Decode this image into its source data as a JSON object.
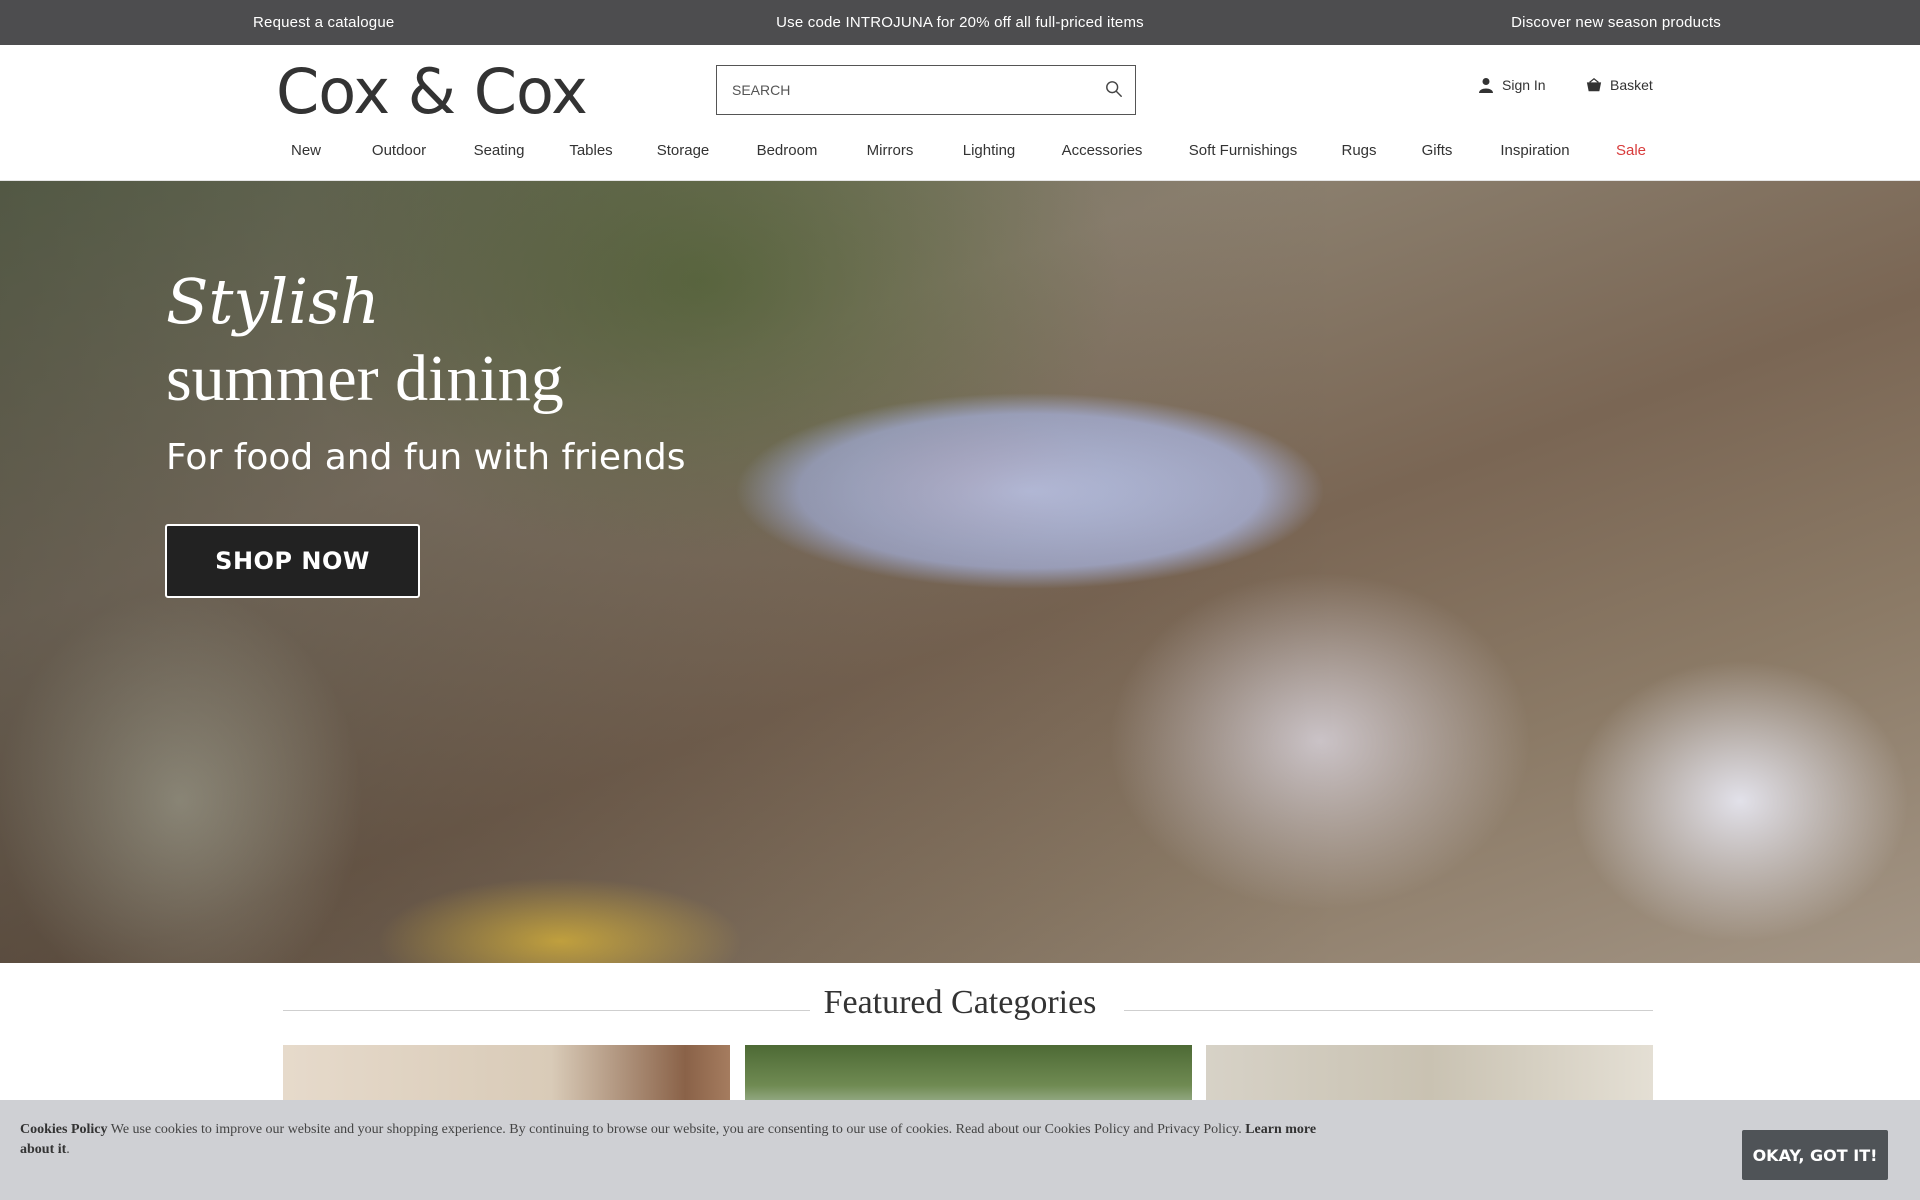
{
  "promo": {
    "left": "Request a catalogue",
    "center": "Use code INTROJUNA for 20% off all full-priced items",
    "right": "Discover new season products"
  },
  "header": {
    "logo": "Cox & Cox",
    "search_placeholder": "SEARCH",
    "sign_in": "Sign In",
    "basket": "Basket"
  },
  "nav": {
    "items": [
      "New",
      "Outdoor",
      "Seating",
      "Tables",
      "Storage",
      "Bedroom",
      "Mirrors",
      "Lighting",
      "Accessories",
      "Soft Furnishings",
      "Rugs",
      "Gifts",
      "Inspiration",
      "Sale"
    ]
  },
  "hero": {
    "title_line1": "Stylish",
    "title_line2": "summer dining",
    "subtitle": "For food and fun with friends",
    "cta": "SHOP NOW"
  },
  "featured": {
    "title": "Featured Categories"
  },
  "cookie": {
    "heading": "Cookies Policy",
    "body": "We use cookies to improve our website and your shopping experience. By continuing to browse our website, you are consenting to our use of cookies. Read about our Cookies Policy and Privacy Policy.",
    "link": "Learn more about it",
    "period": ".",
    "button": "OKAY, GOT IT!"
  },
  "colors": {
    "promo_bg": "#4d4d4f",
    "sale": "#d83b3b",
    "cookie_bg": "#cfd0d4",
    "cookie_button": "#4f5357"
  }
}
